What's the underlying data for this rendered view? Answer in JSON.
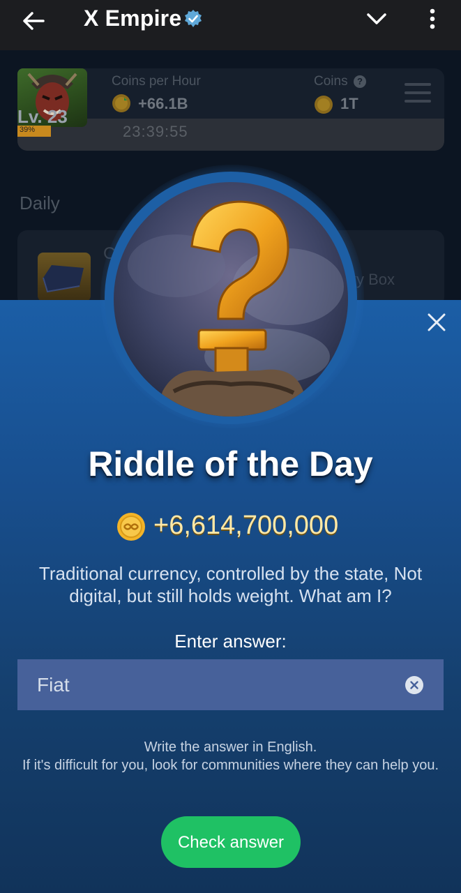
{
  "app": {
    "title": "X Empire"
  },
  "stats": {
    "level": "Lv. 23",
    "level_progress_pct": "39%",
    "level_progress": 0.39,
    "coins_per_hour_label": "Coins per Hour",
    "coins_per_hour_value": "+66.1B",
    "coins_label": "Coins",
    "coins_value": "1T",
    "timer": "23:39:55"
  },
  "daily": {
    "section_label": "Daily",
    "item_text_partial": "Co",
    "lucky_text_partial": "ky Box"
  },
  "riddle": {
    "title": "Riddle of the Day",
    "reward": "+6,614,700,000",
    "question": "Traditional currency, controlled by the state, Not digital, but still holds weight. What am I?",
    "answer_label": "Enter answer:",
    "answer_value": "Fiat",
    "hint_line1": "Write the answer in English.",
    "hint_line2": "If it's difficult for you, look for communities where they can help you.",
    "check_button": "Check answer"
  },
  "colors": {
    "modal_top": "#1b5ea6",
    "modal_bottom": "#11335a",
    "check_button": "#1fc164",
    "coin": "#f3b428"
  },
  "icons": {
    "back": "back-arrow-icon",
    "verified": "verified-badge-icon",
    "chevron": "chevron-down-icon",
    "menu": "more-vertical-icon",
    "close": "close-icon",
    "clear": "clear-circle-icon",
    "coin": "coin-icon",
    "hamburger": "hamburger-menu-icon"
  }
}
